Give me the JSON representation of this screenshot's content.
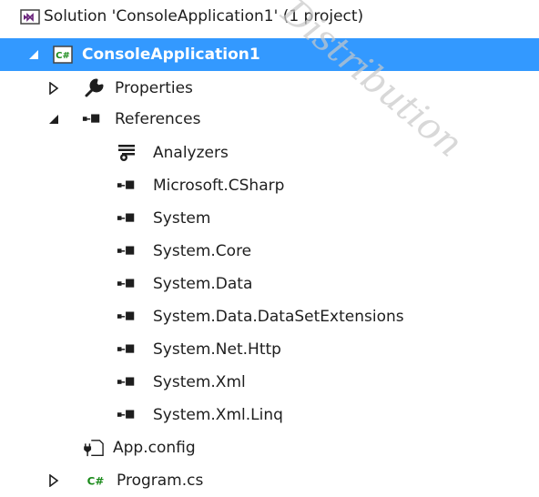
{
  "solution": {
    "label": "Solution 'ConsoleApplication1' (1 project)",
    "icon": "solution-icon"
  },
  "project": {
    "label": "ConsoleApplication1",
    "icon": "csharp-project-icon",
    "selected": true
  },
  "properties": {
    "label": "Properties",
    "icon": "wrench-icon"
  },
  "references": {
    "label": "References",
    "icon": "references-icon",
    "items": [
      {
        "label": "Analyzers",
        "icon": "analyzers-icon"
      },
      {
        "label": "Microsoft.CSharp",
        "icon": "reference-icon"
      },
      {
        "label": "System",
        "icon": "reference-icon"
      },
      {
        "label": "System.Core",
        "icon": "reference-icon"
      },
      {
        "label": "System.Data",
        "icon": "reference-icon"
      },
      {
        "label": "System.Data.DataSetExtensions",
        "icon": "reference-icon"
      },
      {
        "label": "System.Net.Http",
        "icon": "reference-icon"
      },
      {
        "label": "System.Xml",
        "icon": "reference-icon"
      },
      {
        "label": "System.Xml.Linq",
        "icon": "reference-icon"
      }
    ]
  },
  "app_config": {
    "label": "App.config",
    "icon": "config-file-icon"
  },
  "program": {
    "label": "Program.cs",
    "icon": "csharp-file-icon"
  },
  "watermark": {
    "text": "Distribution"
  },
  "colors": {
    "selection": "#3399ff",
    "csharp_green": "#1a8a1a",
    "solution_purple": "#68217a"
  }
}
